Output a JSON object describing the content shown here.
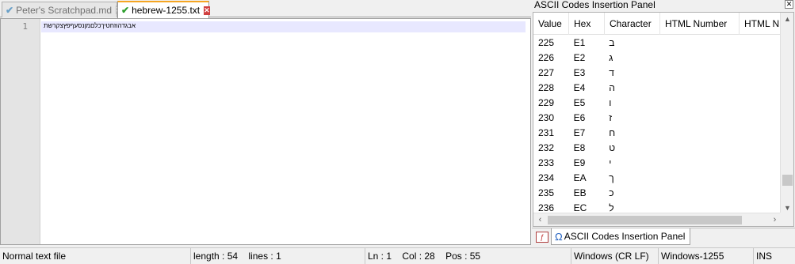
{
  "tabs": [
    {
      "label": "Peter's Scratchpad.md",
      "active": false
    },
    {
      "label": "hebrew-1255.txt",
      "active": true
    }
  ],
  "editor": {
    "line_number": "1",
    "content": "אבגדהוזחטיךכלםמןנסעףפץצקרשת"
  },
  "panel": {
    "title": "ASCII Codes Insertion Panel",
    "columns": [
      "Value",
      "Hex",
      "Character",
      "HTML Number",
      "HTML N"
    ],
    "rows": [
      {
        "value": "225",
        "hex": "E1",
        "char": "ב"
      },
      {
        "value": "226",
        "hex": "E2",
        "char": "ג"
      },
      {
        "value": "227",
        "hex": "E3",
        "char": "ד"
      },
      {
        "value": "228",
        "hex": "E4",
        "char": "ה"
      },
      {
        "value": "229",
        "hex": "E5",
        "char": "ו"
      },
      {
        "value": "230",
        "hex": "E6",
        "char": "ז"
      },
      {
        "value": "231",
        "hex": "E7",
        "char": "ח"
      },
      {
        "value": "232",
        "hex": "E8",
        "char": "ט"
      },
      {
        "value": "233",
        "hex": "E9",
        "char": "י"
      },
      {
        "value": "234",
        "hex": "EA",
        "char": "ך"
      },
      {
        "value": "235",
        "hex": "EB",
        "char": "כ"
      },
      {
        "value": "236",
        "hex": "EC",
        "char": "ל"
      }
    ],
    "bottom_tab_label": "ASCII Codes Insertion Panel"
  },
  "status": {
    "file_type": "Normal text file",
    "length": "length : 54",
    "lines": "lines : 1",
    "ln": "Ln : 1",
    "col": "Col : 28",
    "pos": "Pos : 55",
    "eol": "Windows (CR LF)",
    "encoding": "Windows-1255",
    "mode": "INS"
  },
  "colors": {
    "active_tab_accent": "#f5a623",
    "current_line": "#e8e8ff",
    "saved_check": "#2e9e2e"
  },
  "icons": {
    "tab_status": "check-icon",
    "tab_close": "close-icon",
    "panel_tab": "omega-icon"
  }
}
